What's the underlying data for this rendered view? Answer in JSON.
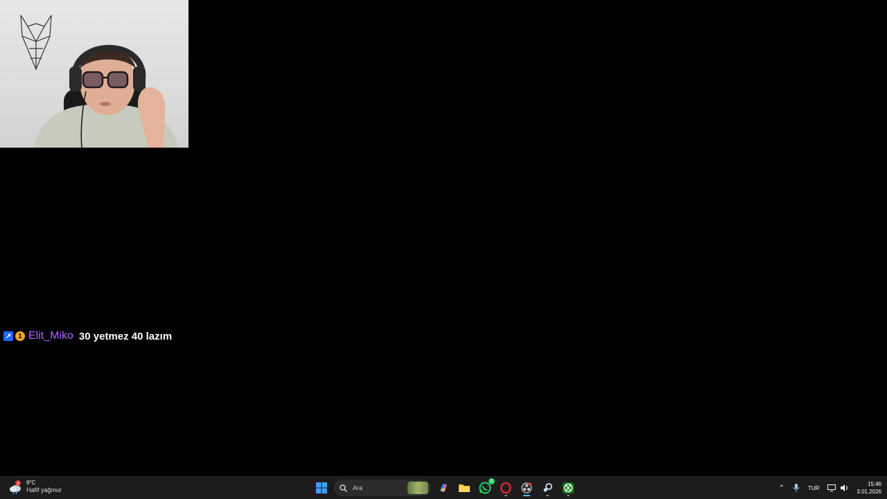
{
  "chat": {
    "username": "Elit_Miko",
    "message": "30 yetmez 40 lazım",
    "badge_prime": "↗",
    "badge_sub": "1"
  },
  "taskbar": {
    "weather_badge": "3",
    "weather_temp": "9°C",
    "weather_cond": "Hafif yağmur",
    "search_placeholder": "Ara",
    "whatsapp_badge": "2",
    "language": "TUR",
    "time": "15:46",
    "date": "3.01.2026"
  },
  "icons": [
    "wolf-logo-icon",
    "start-icon",
    "search-icon",
    "copilot-icon",
    "folder-icon",
    "whatsapp-icon",
    "opera-icon",
    "obs-icon",
    "steam-icon",
    "xbox-icon",
    "chevron-up-icon",
    "microphone-icon",
    "display-icon",
    "speaker-icon"
  ]
}
